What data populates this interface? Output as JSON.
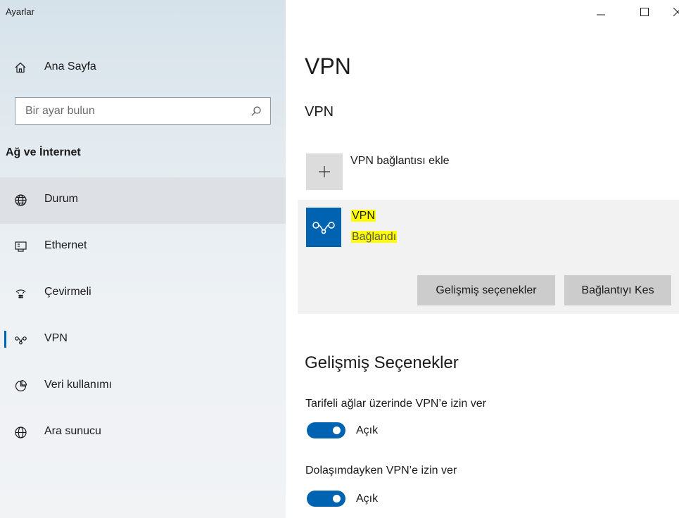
{
  "window": {
    "title": "Ayarlar"
  },
  "sidebar": {
    "home_label": "Ana Sayfa",
    "search": {
      "placeholder": "Bir ayar bulun"
    },
    "section_title": "Ağ ve İnternet",
    "items": [
      {
        "label": "Durum",
        "icon": "globe-status-icon",
        "selected": true
      },
      {
        "label": "Ethernet",
        "icon": "ethernet-icon",
        "selected": false
      },
      {
        "label": "Çevirmeli",
        "icon": "dialup-icon",
        "selected": false
      },
      {
        "label": "VPN",
        "icon": "vpn-icon",
        "selected": false,
        "active_indicator": true
      },
      {
        "label": "Veri kullanımı",
        "icon": "data-usage-icon",
        "selected": false
      },
      {
        "label": "Ara sunucu",
        "icon": "proxy-globe-icon",
        "selected": false
      }
    ]
  },
  "main": {
    "page_title": "VPN",
    "vpn_section_title": "VPN",
    "add_vpn_label": "VPN bağlantısı ekle",
    "connection": {
      "name": "VPN",
      "status": "Bağlandı",
      "advanced_button": "Gelişmiş seçenekler",
      "disconnect_button": "Bağlantıyı Kes"
    },
    "advanced": {
      "title": "Gelişmiş Seçenekler",
      "options": [
        {
          "label": "Tarifeli ağlar üzerinde VPN’e izin ver",
          "state": "Açık",
          "on": true
        },
        {
          "label": "Dolaşımdayken VPN’e izin ver",
          "state": "Açık",
          "on": true
        }
      ]
    }
  },
  "colors": {
    "accent": "#0063b1",
    "highlight": "#ffff00",
    "button_bg": "#cccccc",
    "card_bg": "#f2f2f2",
    "selected_nav_bg": "#dde1e5"
  }
}
